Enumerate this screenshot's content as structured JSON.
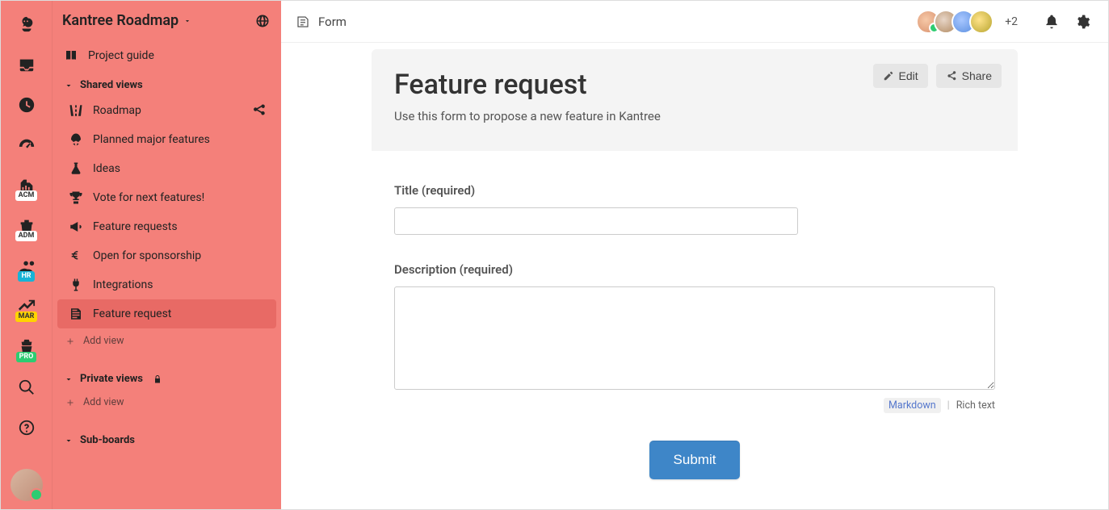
{
  "rail": {
    "badges": {
      "acm": "ACM",
      "adm": "ADM",
      "hr": "HR",
      "mar": "MAR",
      "pro": "PRO"
    }
  },
  "sidebar": {
    "title": "Kantree Roadmap",
    "project_guide": "Project guide",
    "sections": {
      "shared": "Shared views",
      "private": "Private views",
      "subboards": "Sub-boards"
    },
    "views": [
      {
        "label": "Roadmap"
      },
      {
        "label": "Planned major features"
      },
      {
        "label": "Ideas"
      },
      {
        "label": "Vote for next features!"
      },
      {
        "label": "Feature requests"
      },
      {
        "label": "Open for sponsorship"
      },
      {
        "label": "Integrations"
      },
      {
        "label": "Feature request"
      }
    ],
    "add_view": "Add view"
  },
  "topbar": {
    "title": "Form",
    "plus": "+2"
  },
  "form": {
    "heading": "Feature request",
    "subtitle": "Use this form to propose a new feature in Kantree",
    "edit": "Edit",
    "share": "Share",
    "title_label": "Title (required)",
    "description_label": "Description (required)",
    "markdown": "Markdown",
    "richtext": "Rich text",
    "submit": "Submit"
  }
}
